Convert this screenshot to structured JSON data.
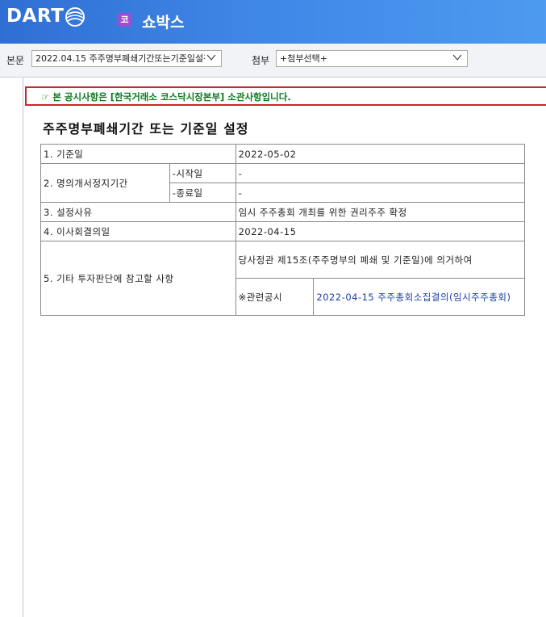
{
  "header": {
    "logo_text": "DART",
    "company_badge": "코",
    "company_name": "쇼박스"
  },
  "toolbar": {
    "main_label": "본문",
    "main_select_value": "2022.04.15  주주명부폐쇄기간또는기준일설정",
    "attach_label": "첨부",
    "attach_select_value": "+첨부선택+"
  },
  "notice": {
    "text": "☞ 본 공시사항은 [한국거래소 코스닥시장본부] 소관사항입니다."
  },
  "document": {
    "title": "주주명부폐쇄기간 또는 기준일 설정",
    "rows": {
      "r1_label": "1. 기준일",
      "r1_value": "2022-05-02",
      "r2_label": "2. 명의개서정지기간",
      "r2_start_label": "-시작일",
      "r2_start_value": "-",
      "r2_end_label": "-종료일",
      "r2_end_value": "-",
      "r3_label": "3. 설정사유",
      "r3_value": "임시 주주총회 개최를 위한 권리주주 확정",
      "r4_label": "4. 이사회결의일",
      "r4_value": "2022-04-15",
      "r5_label": "5. 기타 투자판단에 참고할 사항",
      "r5_value": "당사정관 제15조(주주명부의 폐쇄 및 기준일)에 의거하여",
      "r5_related_label": "※관련공시",
      "r5_related_link": "2022-04-15 주주총회소집결의(임시주주총회)"
    }
  },
  "colors": {
    "header_blue": "#3f86e6",
    "notice_border": "#d0252c",
    "notice_text": "#0a7a1e",
    "badge_purple": "#9b4fd6",
    "link": "#1a3fa8"
  }
}
